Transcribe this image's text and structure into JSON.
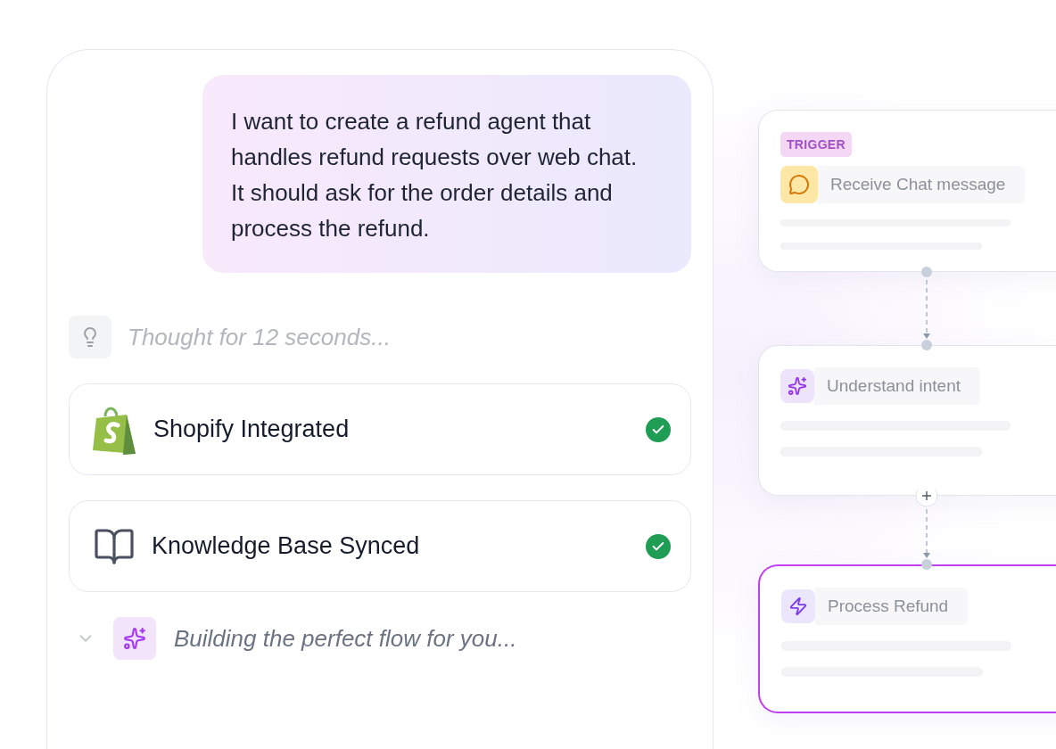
{
  "chat": {
    "message": "I want to create a refund agent that handles refund requests over web chat. It should ask for the order details and process the refund.",
    "thought": "Thought for 12 seconds...",
    "steps": [
      {
        "kind": "shopify",
        "label": "Shopify Integrated",
        "done": true
      },
      {
        "kind": "book",
        "label": "Knowledge Base Synced",
        "done": true
      }
    ],
    "building": "Building the perfect flow for you..."
  },
  "flow": {
    "nodes": [
      {
        "kind": "chat",
        "badge": "TRIGGER",
        "label": "Receive Chat message",
        "selected": false
      },
      {
        "kind": "sparkle",
        "label": "Understand intent",
        "selected": false,
        "add_before": false
      },
      {
        "kind": "bolt",
        "label": "Process Refund",
        "selected": true,
        "add_before": true
      }
    ]
  }
}
